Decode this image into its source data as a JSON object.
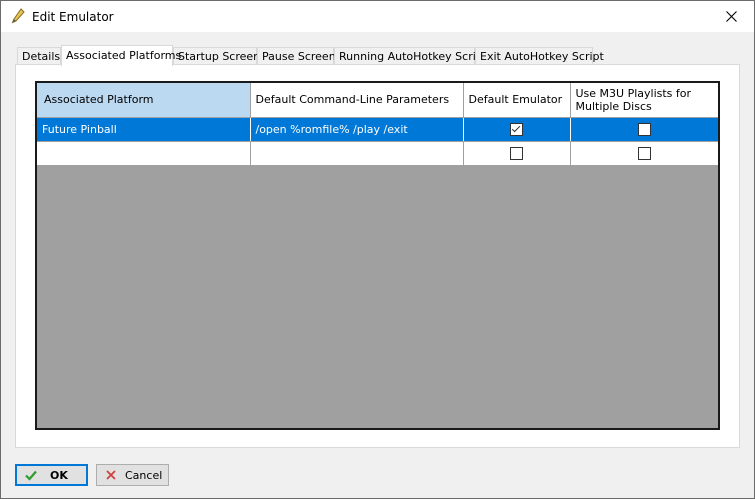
{
  "window": {
    "title": "Edit Emulator"
  },
  "tabs": [
    {
      "label": "Details"
    },
    {
      "label": "Associated Platforms"
    },
    {
      "label": "Startup Screen"
    },
    {
      "label": "Pause Screen"
    },
    {
      "label": "Running AutoHotkey Script"
    },
    {
      "label": "Exit AutoHotkey Script"
    }
  ],
  "active_tab": "Associated Platforms",
  "grid": {
    "headers": [
      "Associated Platform",
      "Default Command-Line Parameters",
      "Default Emulator",
      "Use M3U Playlists for Multiple Discs"
    ],
    "rows": [
      {
        "platform": "Future Pinball",
        "params": "/open %romfile% /play /exit",
        "default_emulator": true,
        "use_m3u": false,
        "selected": true
      },
      {
        "platform": "",
        "params": "",
        "default_emulator": false,
        "use_m3u": false,
        "selected": false
      }
    ]
  },
  "buttons": {
    "ok": "OK",
    "cancel": "Cancel"
  },
  "colors": {
    "selection": "#0078d7",
    "header_selected": "#bcd9f2",
    "grid_empty": "#a0a0a0"
  },
  "icons": {
    "title": "pencil-icon",
    "close": "close-icon",
    "ok": "checkmark-icon",
    "cancel": "x-icon"
  }
}
